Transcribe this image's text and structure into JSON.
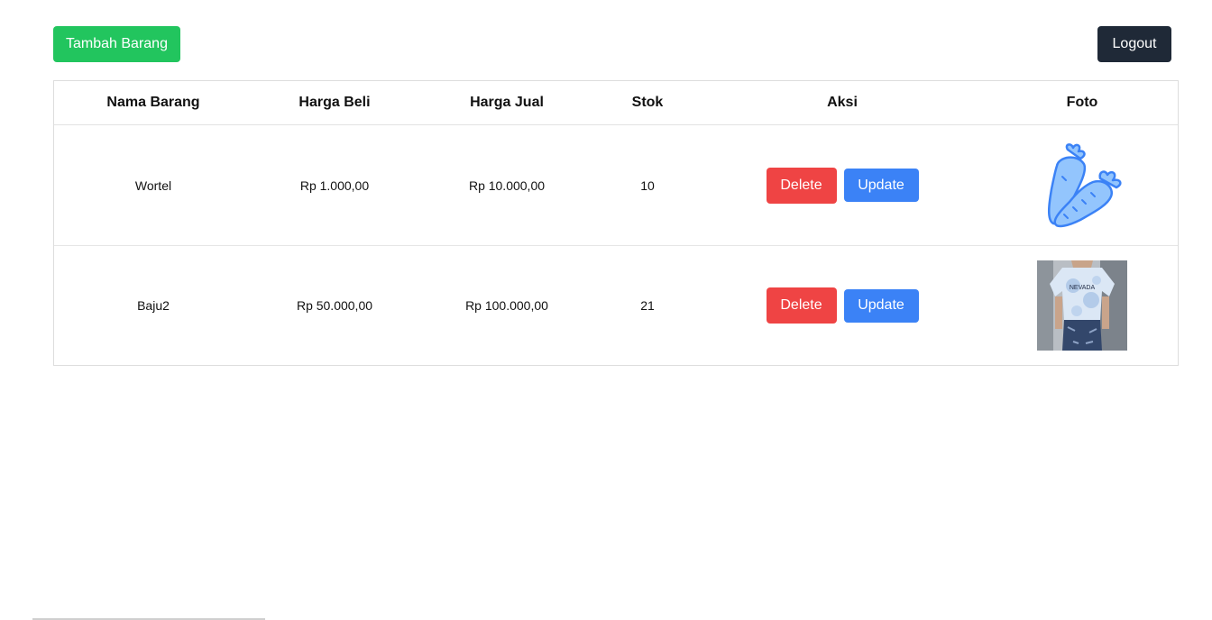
{
  "toolbar": {
    "add_label": "Tambah Barang",
    "logout_label": "Logout"
  },
  "colors": {
    "add_button": "#22c55e",
    "logout_button": "#1f2937",
    "delete_button": "#ef4444",
    "update_button": "#3b82f6"
  },
  "table": {
    "headers": {
      "name": "Nama Barang",
      "buy": "Harga Beli",
      "sell": "Harga Jual",
      "stock": "Stok",
      "action": "Aksi",
      "photo": "Foto"
    },
    "rows": [
      {
        "name": "Wortel",
        "buy": "Rp 1.000,00",
        "sell": "Rp 10.000,00",
        "stock": "10",
        "delete_label": "Delete",
        "update_label": "Update",
        "photo_icon": "carrot-icon"
      },
      {
        "name": "Baju2",
        "buy": "Rp 50.000,00",
        "sell": "Rp 100.000,00",
        "stock": "21",
        "delete_label": "Delete",
        "update_label": "Update",
        "photo_icon": "shirt-photo",
        "photo_text": "NEVADA"
      }
    ]
  }
}
